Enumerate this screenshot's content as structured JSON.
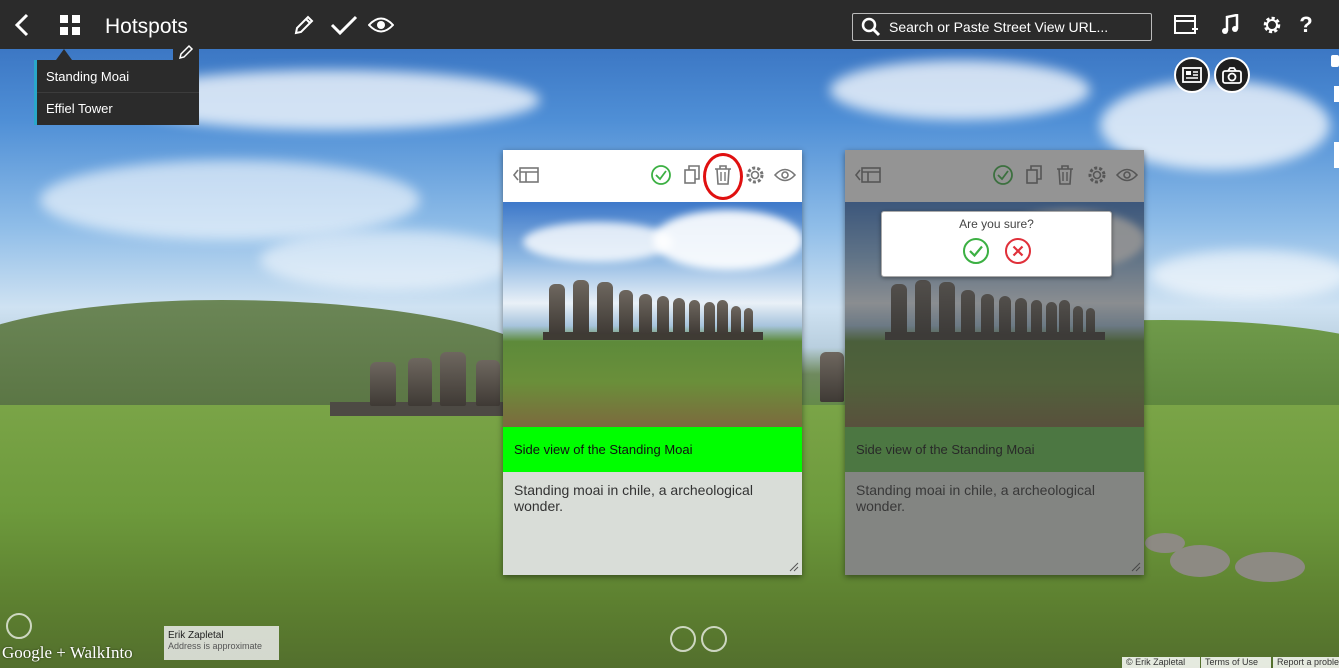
{
  "topbar": {
    "title": "Hotspots",
    "search_placeholder": "Search or Paste Street View URL...",
    "help_label": "?"
  },
  "dropdown": {
    "items": [
      {
        "label": "Standing Moai"
      },
      {
        "label": "Effiel Tower"
      }
    ]
  },
  "cards": [
    {
      "caption": "Side view of the Standing Moai",
      "description": "Standing moai in chile, a archeological wonder."
    },
    {
      "caption": "Side view of the Standing Moai",
      "description": "Standing moai in chile, a archeological wonder.",
      "confirm": {
        "question": "Are you sure?"
      }
    }
  ],
  "footer": {
    "logo_text": "Google + WalkInto",
    "credit_name": "Erik Zapletal",
    "credit_note": "Address is approximate",
    "copyright": "© Erik Zapletal",
    "terms": "Terms of Use",
    "report": "Report a problem"
  },
  "colors": {
    "toolbar_bg": "#2b2b2b",
    "caption_green": "#00ff00",
    "confirm_ok": "#3cb043",
    "confirm_cancel": "#e0303a",
    "highlight": "#e01010",
    "dropdown_accent": "#2aa7c9"
  }
}
